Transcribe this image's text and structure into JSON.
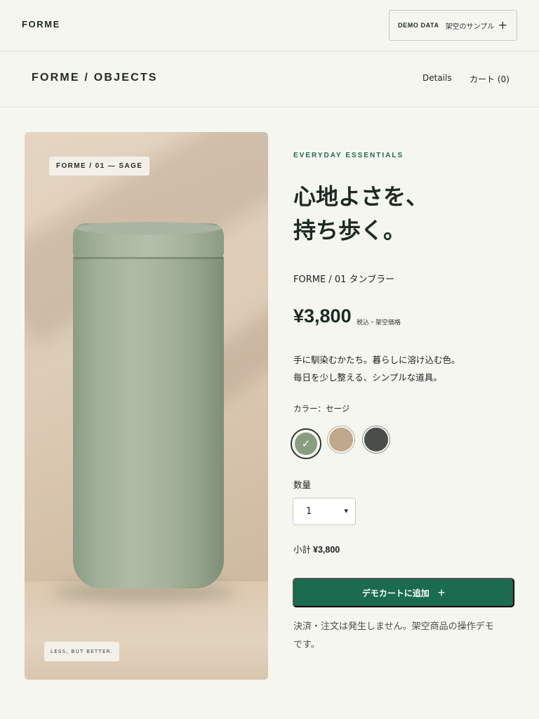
{
  "topbar": {
    "brand": "FORME",
    "demo_key": "DEMO DATA",
    "demo_value": "架空のサンプル",
    "demo_icon": "plus-icon"
  },
  "nav": {
    "breadcrumb": "FORME / OBJECTS",
    "details": "Details",
    "cart": "カート (0)"
  },
  "image": {
    "tag": "FORME / 01 — SAGE",
    "motto": "LESS, BUT BETTER."
  },
  "product": {
    "eyebrow": "EVERYDAY ESSENTIALS",
    "headline_line1": "心地よさを、",
    "headline_line2": "持ち歩く。",
    "name": "FORME / 01 タンブラー",
    "price": "¥3,800",
    "price_note": "税込・架空価格",
    "desc_line1": "手に馴染むかたち。暮らしに溶け込む色。",
    "desc_line2": "毎日を少し整える、シンプルな道具。",
    "color_label": "カラー：セージ",
    "colors": [
      {
        "name": "sage",
        "hex": "#8a9d7e",
        "selected": true
      },
      {
        "name": "sand",
        "hex": "#bfa98a",
        "selected": false
      },
      {
        "name": "charcoal",
        "hex": "#4a4d4a",
        "selected": false
      }
    ],
    "check_glyph": "✓",
    "qty_label": "数量",
    "qty_value": "1",
    "qty_chevron": "⌄",
    "subtotal_label": "小計",
    "subtotal_value": "¥3,800",
    "cta_label": "デモカートに追加",
    "cta_plus": "+",
    "note_line1": "決済・注文は発生しません。架空商品の操作デモ",
    "note_line2": "です。"
  },
  "colors": {
    "accent": "#1a6b4f",
    "background": "#f6f6f1",
    "text": "#1d2b22"
  }
}
